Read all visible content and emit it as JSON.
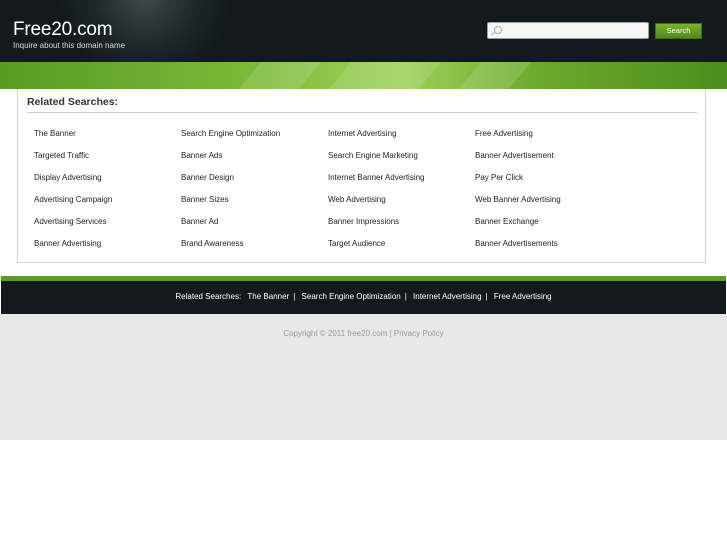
{
  "header": {
    "title": "Free20.com",
    "subtitle": "Inquire about this domain name",
    "search_placeholder": "",
    "search_button": "Search"
  },
  "related": {
    "title": "Related Searches:",
    "columns": [
      [
        "The Banner",
        "Targeted Traffic",
        "Display Advertising",
        "Advertising Campaign",
        "Advertising Services",
        "Banner Advertising"
      ],
      [
        "Search Engine Optimization",
        "Banner Ads",
        "Banner Design",
        "Banner Sizes",
        "Banner Ad",
        "Brand Awareness"
      ],
      [
        "Internet Advertising",
        "Search Engine Marketing",
        "Internet Banner Advertising",
        "Web Advertising",
        "Banner Impressions",
        "Target Audience"
      ],
      [
        "Free Advertising",
        "Banner Advertisement",
        "Pay Per Click",
        "Web Banner Advertising",
        "Banner Exchange",
        "Banner Advertisements"
      ]
    ]
  },
  "footer": {
    "label": "Related Searches:",
    "links": [
      "The Banner",
      "Search Engine Optimization",
      "Internet Advertising",
      "Free Advertising"
    ],
    "separator": "|",
    "copyright": "Copyright © 2011 free20.com",
    "privacy": "Privacy Policy"
  },
  "colors": {
    "header_bg": "#121a1e",
    "accent_green": "#5c9c22",
    "footer_bg": "#e8e8e8"
  }
}
